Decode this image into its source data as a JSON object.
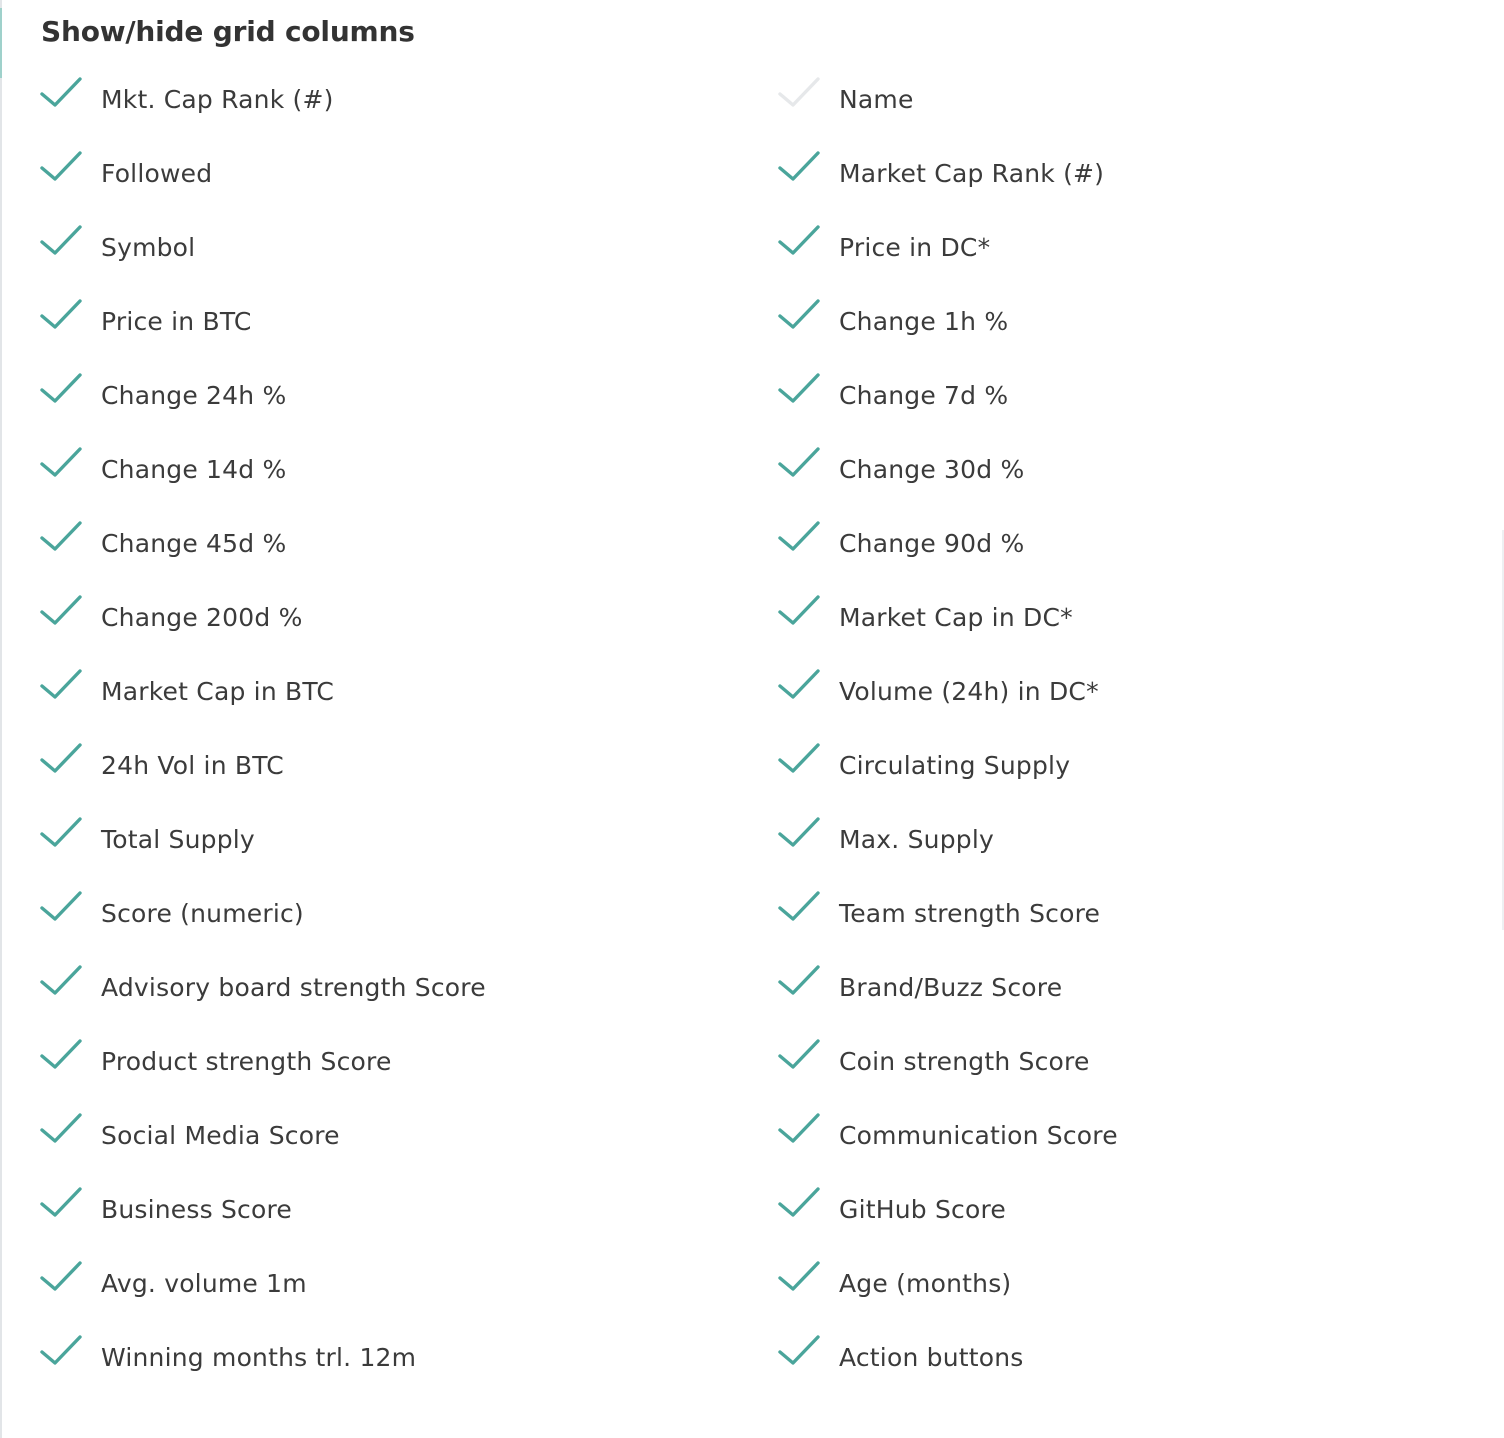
{
  "title": "Show/hide grid columns",
  "accent_color": "#4aa59b",
  "disabled_check_color": "#e6e8ea",
  "columns": {
    "left": [
      {
        "label": "Mkt. Cap Rank (#)",
        "checked": true
      },
      {
        "label": "Followed",
        "checked": true
      },
      {
        "label": "Symbol",
        "checked": true
      },
      {
        "label": "Price in BTC",
        "checked": true
      },
      {
        "label": "Change 24h %",
        "checked": true
      },
      {
        "label": "Change 14d %",
        "checked": true
      },
      {
        "label": "Change 45d %",
        "checked": true
      },
      {
        "label": "Change 200d %",
        "checked": true
      },
      {
        "label": "Market Cap in BTC",
        "checked": true
      },
      {
        "label": "24h Vol in BTC",
        "checked": true
      },
      {
        "label": "Total Supply",
        "checked": true
      },
      {
        "label": "Score (numeric)",
        "checked": true
      },
      {
        "label": "Advisory board strength Score",
        "checked": true
      },
      {
        "label": "Product strength Score",
        "checked": true
      },
      {
        "label": "Social Media Score",
        "checked": true
      },
      {
        "label": "Business Score",
        "checked": true
      },
      {
        "label": "Avg. volume 1m",
        "checked": true
      },
      {
        "label": "Winning months trl. 12m",
        "checked": true
      }
    ],
    "right": [
      {
        "label": "Name",
        "checked": false
      },
      {
        "label": "Market Cap Rank (#)",
        "checked": true
      },
      {
        "label": "Price in DC*",
        "checked": true
      },
      {
        "label": "Change 1h %",
        "checked": true
      },
      {
        "label": "Change 7d %",
        "checked": true
      },
      {
        "label": "Change 30d %",
        "checked": true
      },
      {
        "label": "Change 90d %",
        "checked": true
      },
      {
        "label": "Market Cap in DC*",
        "checked": true
      },
      {
        "label": "Volume (24h) in DC*",
        "checked": true
      },
      {
        "label": "Circulating Supply",
        "checked": true
      },
      {
        "label": "Max. Supply",
        "checked": true
      },
      {
        "label": "Team strength Score",
        "checked": true
      },
      {
        "label": "Brand/Buzz Score",
        "checked": true
      },
      {
        "label": "Coin strength Score",
        "checked": true
      },
      {
        "label": "Communication Score",
        "checked": true
      },
      {
        "label": "GitHub Score",
        "checked": true
      },
      {
        "label": "Age (months)",
        "checked": true
      },
      {
        "label": "Action buttons",
        "checked": true
      }
    ]
  }
}
